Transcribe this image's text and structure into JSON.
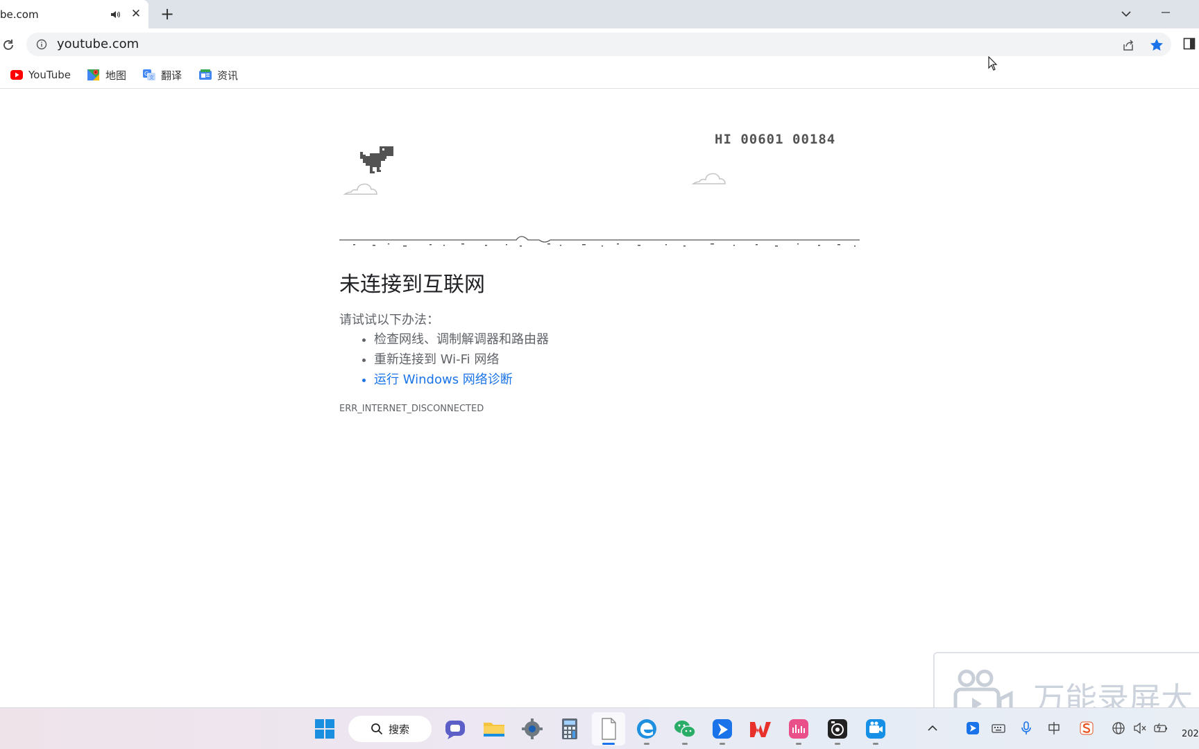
{
  "tab": {
    "title": "be.com"
  },
  "address_bar": {
    "url": "youtube.com"
  },
  "bookmarks": [
    {
      "label": "YouTube",
      "icon": "youtube-icon"
    },
    {
      "label": "地图",
      "icon": "maps-icon"
    },
    {
      "label": "翻译",
      "icon": "translate-icon"
    },
    {
      "label": "资讯",
      "icon": "news-icon"
    }
  ],
  "game": {
    "high_score_label": "HI",
    "high_score": "00601",
    "current_score": "00184"
  },
  "error": {
    "heading": "未连接到互联网",
    "intro": "请试试以下办法：",
    "suggestions": [
      "检查网线、调制解调器和路由器",
      "重新连接到 Wi-Fi 网络",
      "运行 Windows 网络诊断"
    ],
    "code": "ERR_INTERNET_DISCONNECTED"
  },
  "watermark": {
    "text": "万能录屏大"
  },
  "taskbar": {
    "search_label": "搜索",
    "clock": "202"
  },
  "colors": {
    "accent": "#1a73e8",
    "tabstrip": "#dee3ea",
    "dino": "#535353"
  }
}
